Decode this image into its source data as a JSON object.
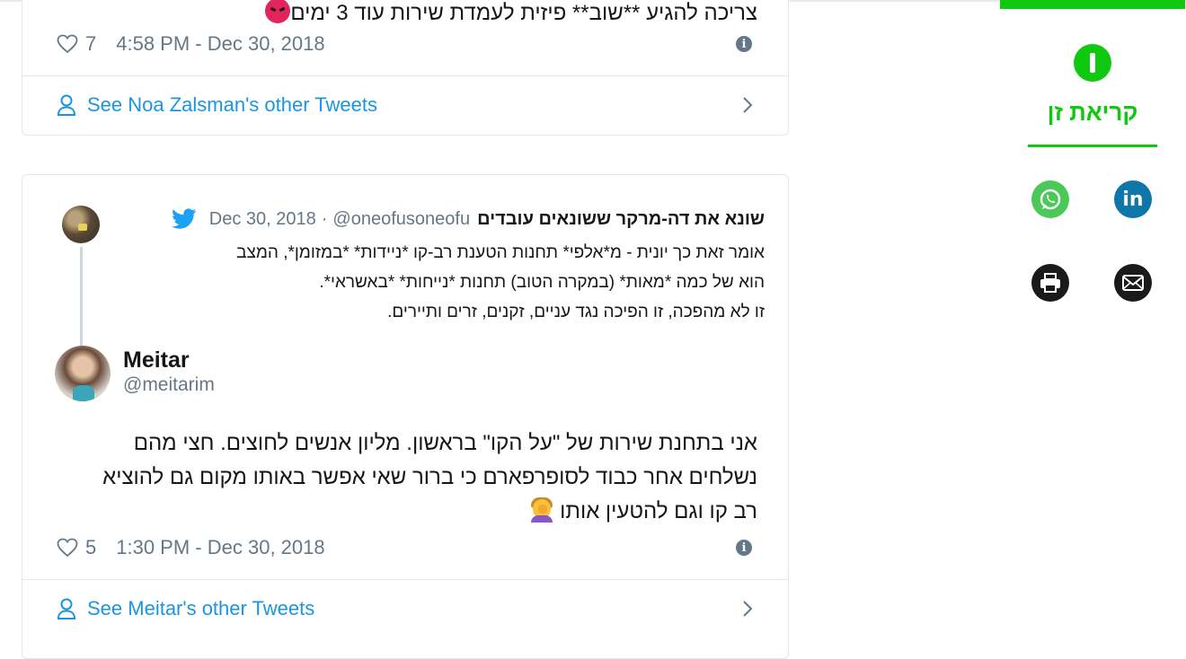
{
  "tweet1": {
    "text_line": "צריכה להגיע **שוב** פיזית לעמדת שירות עוד 3 ימים",
    "emoji": "angry-face",
    "likes": "7",
    "timestamp": "4:58 PM - Dec 30, 2018",
    "see_more": "See Noa Zalsman's other Tweets"
  },
  "tweet2": {
    "quoted": {
      "name": "שונא את דה-מרקר ששונאים עובדים",
      "handle": "@oneofusoneofu",
      "separator": "·",
      "date": "Dec 30, 2018",
      "lines": [
        "אומר זאת כך יונית - מ*אלפי* תחנות הטענת רב-קו *ניידות* *במזומן*, המצב",
        "הוא של כמה *מאות* (במקרה הטוב) תחנות *נייחות* *באשראי*.",
        "זו לא מהפכה, זו הפיכה נגד עניים, זקנים, זרים ותיירים."
      ]
    },
    "author": {
      "name": "Meitar",
      "handle": "@meitarim"
    },
    "lines": [
      "אני בתחנת שירות של \"על הקו\" בראשון. מליון אנשים לחוצים. חצי מהם",
      "נשלחים אחר כבוד לסופרפארם כי ברור שאי אפשר באותו מקום גם להוציא",
      "רב קו וגם להטעין אותו"
    ],
    "emoji": "facepalm",
    "likes": "5",
    "timestamp": "1:30 PM - Dec 30, 2018",
    "see_more": "See Meitar's other Tweets"
  },
  "sidebar": {
    "zen_label": "קריאת זן",
    "share": [
      "whatsapp-icon",
      "linkedin-icon",
      "print-icon",
      "email-icon"
    ],
    "linkedin_text": "in",
    "accent": "#11c811"
  },
  "colors": {
    "link": "#1b95e0",
    "muted": "#657786",
    "border": "#e1e8ed"
  }
}
